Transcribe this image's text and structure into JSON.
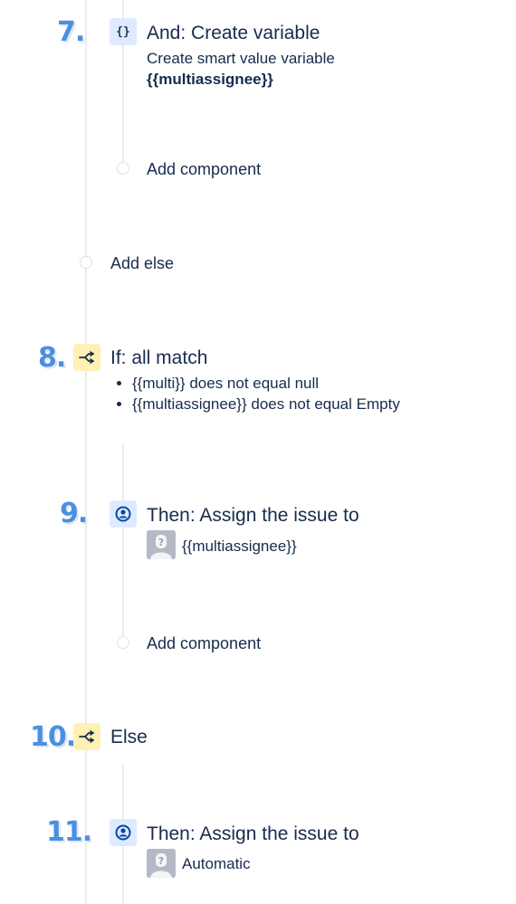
{
  "steps": {
    "s7": {
      "number": "7.",
      "title": "And: Create variable",
      "desc": "Create smart value variable",
      "variable": "{{multiassignee}}",
      "add_component": "Add component"
    },
    "add_else": "Add else",
    "s8": {
      "number": "8.",
      "title": "If: all match",
      "conditions": [
        "{{multi}} does not equal null",
        "{{multiassignee}} does not equal Empty"
      ]
    },
    "s9": {
      "number": "9.",
      "title": "Then: Assign the issue to",
      "assignee": "{{multiassignee}}",
      "add_component": "Add component"
    },
    "s10": {
      "number": "10.",
      "title": "Else"
    },
    "s11": {
      "number": "11.",
      "title": "Then: Assign the issue to",
      "assignee": "Automatic"
    }
  },
  "icons": {
    "variable": "curly-braces-icon",
    "condition": "branch-icon",
    "assign": "user-circle-icon",
    "avatar": "default-avatar-icon"
  },
  "colors": {
    "number": "#4a90e2",
    "action_icon_bg": "#deebff",
    "condition_icon_bg": "#fff0b3",
    "text": "#172b4d",
    "connector": "#ebecf0"
  }
}
